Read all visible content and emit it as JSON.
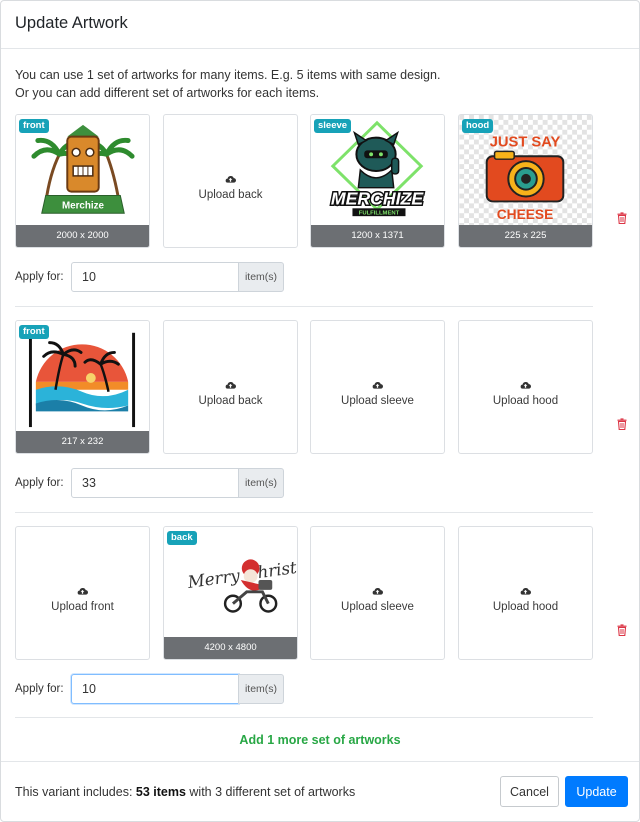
{
  "modal": {
    "title": "Update Artwork"
  },
  "intro": {
    "line1": "You can use 1 set of artworks for many items. E.g. 5 items with same design.",
    "line2": "Or you can add different set of artworks for each items."
  },
  "sets": [
    {
      "front": {
        "badge": "front",
        "dims": "2000 x 2000",
        "art": "merchize-tiki-logo"
      },
      "back": {
        "upload_label": "Upload back",
        "icon": "cloud-upload-icon"
      },
      "sleeve": {
        "badge": "sleeve",
        "dims": "1200 x 1371",
        "art": "merchize-fulfillment-logo",
        "logo_text": "MERCHIZE",
        "logo_sub": "FULFILLMENT"
      },
      "hood": {
        "badge": "hood",
        "dims": "225 x 225",
        "art": "just-say-cheese-camera",
        "top_text": "JUST SAY",
        "bottom_text": "CHEESE"
      },
      "apply_label": "Apply for:",
      "quantity": "10",
      "unit": "item(s)"
    },
    {
      "front": {
        "badge": "front",
        "dims": "217 x 232",
        "art": "palm-tree-sunset"
      },
      "back": {
        "upload_label": "Upload back",
        "icon": "cloud-upload-icon"
      },
      "sleeve": {
        "upload_label": "Upload sleeve",
        "icon": "cloud-upload-icon"
      },
      "hood": {
        "upload_label": "Upload hood",
        "icon": "cloud-upload-icon"
      },
      "apply_label": "Apply for:",
      "quantity": "33",
      "unit": "item(s)"
    },
    {
      "front": {
        "upload_label": "Upload front",
        "icon": "cloud-upload-icon"
      },
      "back": {
        "badge": "back",
        "dims": "4200 x 4800",
        "art": "merry-christmas-motorcycle-santa",
        "script_text": "Merry Christmas"
      },
      "sleeve": {
        "upload_label": "Upload sleeve",
        "icon": "cloud-upload-icon"
      },
      "hood": {
        "upload_label": "Upload hood",
        "icon": "cloud-upload-icon"
      },
      "apply_label": "Apply for:",
      "quantity": "10",
      "unit": "item(s)"
    }
  ],
  "add_more_label": "Add 1 more set of artworks",
  "footer": {
    "summary_prefix": "This variant includes: ",
    "summary_count": "53 items",
    "summary_suffix": " with 3 different set of artworks",
    "cancel_label": "Cancel",
    "update_label": "Update"
  },
  "colors": {
    "badge": "#17a2b8",
    "primary": "#007bff",
    "add_link": "#28a745",
    "delete": "#dc3545",
    "dims_bar": "#6c6f73"
  }
}
